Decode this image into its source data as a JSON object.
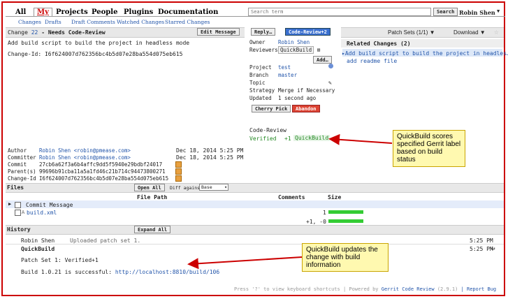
{
  "nav": {
    "all": "All",
    "my": "My",
    "projects": "Projects",
    "people": "People",
    "plugins": "Plugins",
    "documentation": "Documentation"
  },
  "subnav": {
    "changes": "Changes",
    "drafts": "Drafts",
    "draft_comments": "Draft Comments",
    "watched": "Watched Changes",
    "starred": "Starred Changes"
  },
  "search": {
    "placeholder": "Search term",
    "button": "Search"
  },
  "user": {
    "name": "Robin Shen"
  },
  "change": {
    "header_prefix": "Change",
    "number": "22",
    "status": "- Needs Code-Review",
    "edit_message": "Edit Message",
    "reply": "Reply…",
    "code_review_btn": "Code-Review+2",
    "message_line1": "Add build script to build the project in headless mode",
    "message_changeid": "Change-Id: I6f624007d762356bc4b5d07e28ba554d075eb615"
  },
  "info": {
    "owner_label": "Owner",
    "owner": "Robin Shen",
    "reviewers_label": "Reviewers",
    "reviewer": "QuickBuild",
    "add": "Add…",
    "project_label": "Project",
    "project": "test",
    "branch_label": "Branch",
    "branch": "master",
    "topic_label": "Topic",
    "strategy_label": "Strategy",
    "strategy": "Merge if Necessary",
    "updated_label": "Updated",
    "updated": "1 second ago",
    "cherry_pick": "Cherry Pick",
    "abandon": "Abandon",
    "code_review_label": "Code-Review",
    "verified_label": "Verified",
    "verified_score": "+1",
    "verified_by": "QuickBuild"
  },
  "patch": {
    "patch_sets": "Patch Sets (1/1)",
    "download": "Download"
  },
  "related": {
    "title": "Related Changes (2)",
    "item1": "Add build script to build the project in headles…",
    "item2": "add readme file"
  },
  "commit": {
    "author_label": "Author",
    "author": "Robin Shen <robin@pmease.com>",
    "author_date": "Dec 18, 2014 5:25 PM",
    "committer_label": "Committer",
    "committer": "Robin Shen <robin@pmease.com>",
    "committer_date": "Dec 18, 2014 5:25 PM",
    "commit_label": "Commit",
    "commit": "27cb6a62f3a6b4affc9dd5f5940e29bdbf24017",
    "parent_label": "Parent(s)",
    "parent": "99696b91cba11a5a1fd46c21b714c94473800271",
    "changeid_label": "Change-Id",
    "changeid": "I6f624007d762356bc4b5d07e28ba554d075eb615"
  },
  "files": {
    "title": "Files",
    "open_all": "Open All",
    "diff_against": "Diff against:",
    "diff_value": "Base",
    "col_path": "File Path",
    "col_comments": "Comments",
    "col_size": "Size",
    "rows": [
      {
        "name": "Commit Message",
        "size": "1"
      },
      {
        "name": "build.xml",
        "prefix": "A",
        "size": "+1, -0"
      }
    ]
  },
  "history": {
    "title": "History",
    "expand_all": "Expand All",
    "entry1_author": "Robin Shen",
    "entry1_text": "Uploaded patch set 1.",
    "entry1_time": "5:25 PM",
    "entry2_author": "QuickBuild",
    "entry2_time": "5:25 PM",
    "entry2_line1": "Patch Set 1: Verified+1",
    "entry2_line2": "Build 1.0.21 is successful: ",
    "entry2_link": "http://localhost:8810/build/106"
  },
  "footer": {
    "shortcuts": "Press '?' to view keyboard shortcuts",
    "powered": "| Powered by ",
    "gerrit": "Gerrit Code Review",
    "version": "(2.9.1)",
    "report": "| Report Bug"
  },
  "callouts": {
    "c1": "QuickBuild scores specified Gerrit label based on build status",
    "c2": "QuickBuild updates the change with build information"
  },
  "colors": {
    "frame": "#cc0000",
    "link": "#2255aa",
    "verified": "#228822",
    "callout_bg": "#fff9b0"
  }
}
